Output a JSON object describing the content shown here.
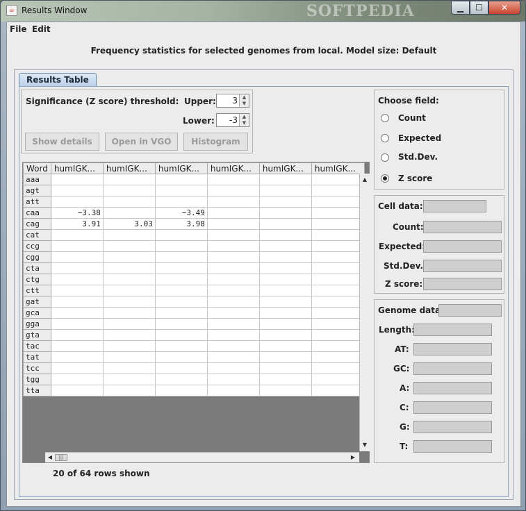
{
  "window": {
    "title": "Results Window",
    "watermark": "SOFTPEDIA",
    "controls": {
      "minimize": "▁",
      "maximize": "☐",
      "close": "✕"
    }
  },
  "menu": {
    "file": "File",
    "edit": "Edit"
  },
  "header": "Frequency statistics for selected genomes from local. Model size: Default",
  "tabs": [
    {
      "label": "Results Table"
    }
  ],
  "threshold": {
    "label": "Significance (Z score) threshold:",
    "upper_label": "Upper:",
    "upper_value": "3",
    "lower_label": "Lower:",
    "lower_value": "-3"
  },
  "buttons": {
    "show_details": "Show details",
    "open_vgo": "Open in VGO",
    "histogram": "Histogram"
  },
  "table": {
    "columns": [
      "Word",
      "humIGK...",
      "humIGK...",
      "humIGK...",
      "humIGK...",
      "humIGK...",
      "humIGK..."
    ],
    "rows": [
      [
        "aaa",
        "",
        "",
        "",
        "",
        "",
        ""
      ],
      [
        "agt",
        "",
        "",
        "",
        "",
        "",
        ""
      ],
      [
        "att",
        "",
        "",
        "",
        "",
        "",
        ""
      ],
      [
        "caa",
        "−3.38",
        "",
        "−3.49",
        "",
        "",
        ""
      ],
      [
        "cag",
        "3.91",
        "3.03",
        "3.98",
        "",
        "",
        ""
      ],
      [
        "cat",
        "",
        "",
        "",
        "",
        "",
        ""
      ],
      [
        "ccg",
        "",
        "",
        "",
        "",
        "",
        ""
      ],
      [
        "cgg",
        "",
        "",
        "",
        "",
        "",
        ""
      ],
      [
        "cta",
        "",
        "",
        "",
        "",
        "",
        ""
      ],
      [
        "ctg",
        "",
        "",
        "",
        "",
        "",
        ""
      ],
      [
        "ctt",
        "",
        "",
        "",
        "",
        "",
        ""
      ],
      [
        "gat",
        "",
        "",
        "",
        "",
        "",
        ""
      ],
      [
        "gca",
        "",
        "",
        "",
        "",
        "",
        ""
      ],
      [
        "gga",
        "",
        "",
        "",
        "",
        "",
        ""
      ],
      [
        "gta",
        "",
        "",
        "",
        "",
        "",
        ""
      ],
      [
        "tac",
        "",
        "",
        "",
        "",
        "",
        ""
      ],
      [
        "tat",
        "",
        "",
        "",
        "",
        "",
        ""
      ],
      [
        "tcc",
        "",
        "",
        "",
        "",
        "",
        ""
      ],
      [
        "tgg",
        "",
        "",
        "",
        "",
        "",
        ""
      ],
      [
        "tta",
        "",
        "",
        "",
        "",
        "",
        ""
      ]
    ],
    "rows_shown": "20 of 64 rows shown"
  },
  "choose_field": {
    "label": "Choose field:",
    "options": [
      "Count",
      "Expected",
      "Std.Dev.",
      "Z score"
    ],
    "selected": "Z score"
  },
  "cell_data": {
    "label": "Cell data:",
    "fields": [
      "Count:",
      "Expected:",
      "Std.Dev.:",
      "Z score:"
    ]
  },
  "genome_data": {
    "label": "Genome data:",
    "fields": [
      "Length:",
      "AT:",
      "GC:",
      "A:",
      "C:",
      "G:",
      "T:"
    ]
  },
  "icons": {
    "window_icon": "java-cup-icon",
    "scroll_up": "▲",
    "scroll_down": "▼",
    "scroll_left": "◀",
    "scroll_right": "▶",
    "grip": "|||"
  }
}
